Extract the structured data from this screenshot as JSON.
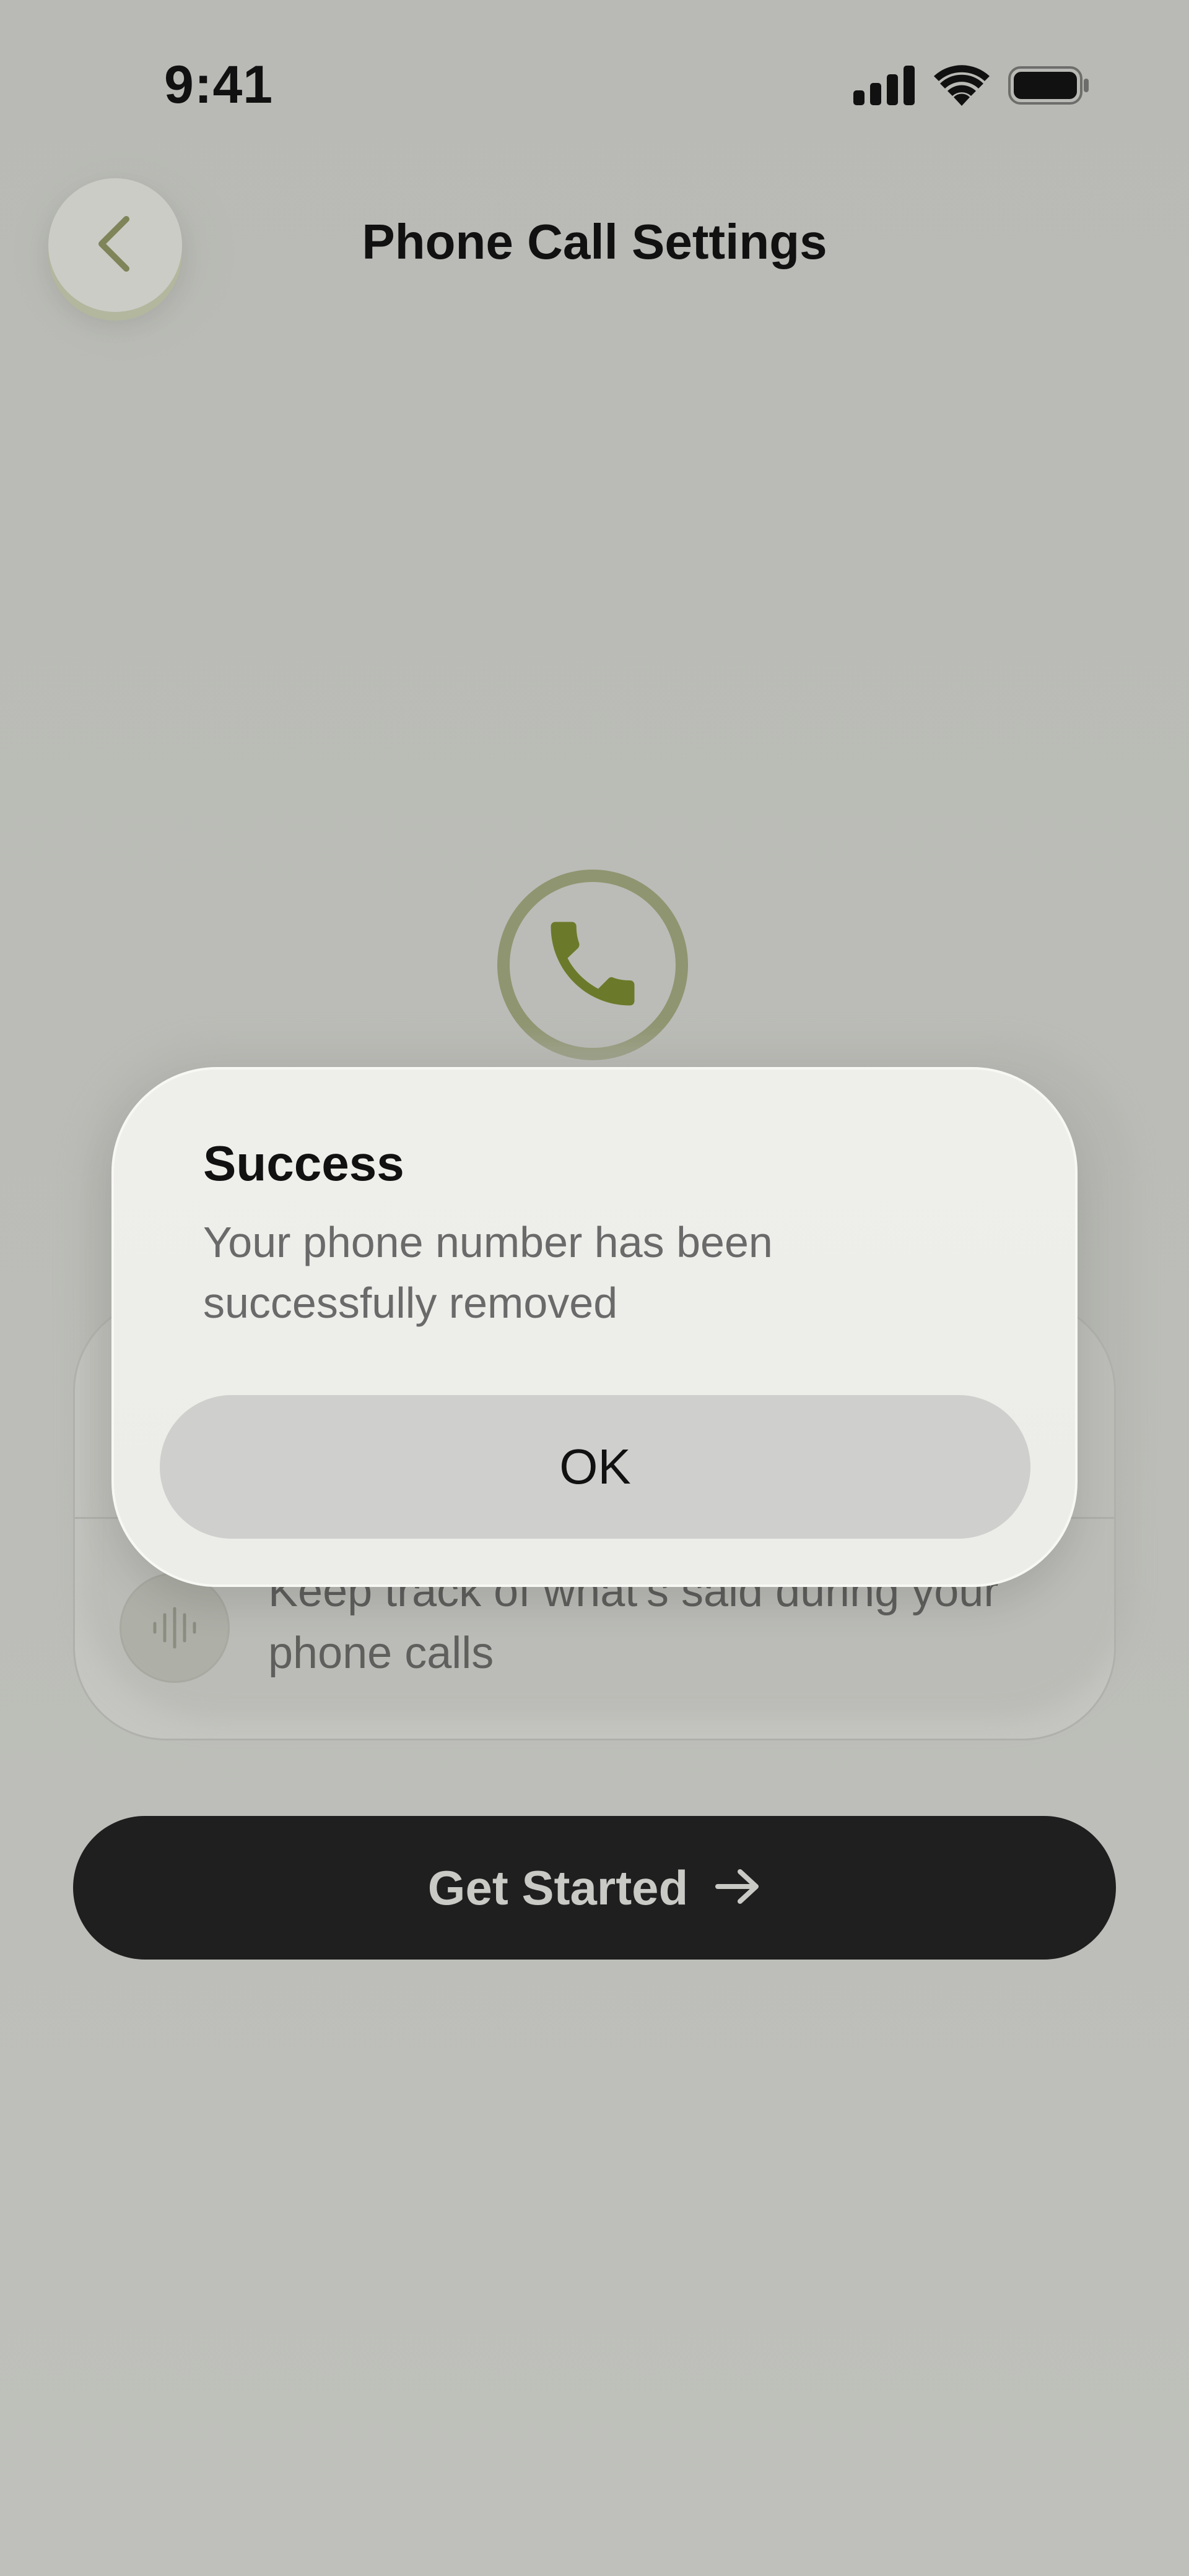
{
  "status_bar": {
    "time": "9:41",
    "icons": [
      "cellular-signal-icon",
      "wifi-icon",
      "battery-icon"
    ]
  },
  "header": {
    "title": "Phone Call Settings",
    "back_icon": "chevron-left-icon"
  },
  "hero": {
    "icon": "phone-icon",
    "accent_color": "#6b7a2a"
  },
  "feature_card": {
    "items": [
      {
        "icon": "waveform-icon",
        "text": "Keep track of what’s said during your phone calls"
      }
    ]
  },
  "primary_action": {
    "label": "Get Started",
    "icon": "arrow-right-icon"
  },
  "dialog": {
    "title": "Success",
    "message": "Your phone number has been successfully removed",
    "ok_label": "OK"
  },
  "colors": {
    "background": "#bbbcb7",
    "dialog_bg": "#eeeeea",
    "primary_button_bg": "#1f1f1f",
    "accent": "#6b7a2a"
  }
}
